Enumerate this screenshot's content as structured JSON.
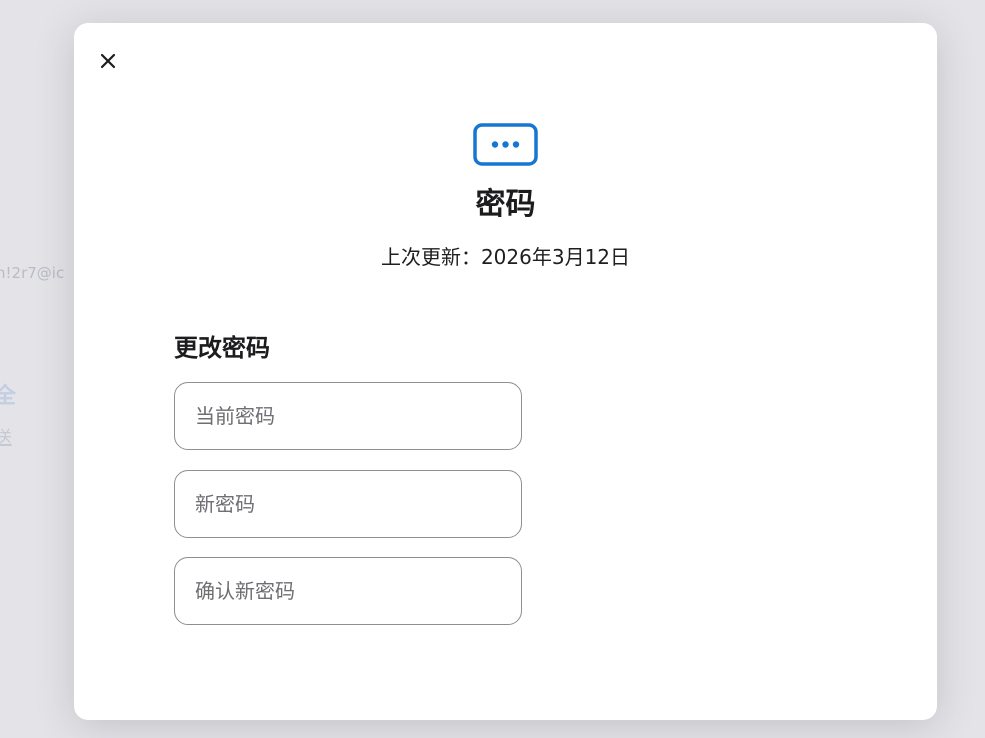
{
  "background": {
    "email_fragment": "h!2r7@ic",
    "glyph_fragment_1": "全",
    "glyph_fragment_2": "送"
  },
  "modal": {
    "close_icon": "close-icon",
    "header_icon": "password-dots-icon",
    "title": "密码",
    "last_updated": "上次更新：2026年3月12日"
  },
  "change_password": {
    "heading": "更改密码",
    "current_placeholder": "当前密码",
    "new_placeholder": "新密码",
    "confirm_placeholder": "确认新密码"
  },
  "colors": {
    "accent": "#1677d2",
    "backdrop": "#e4e4e8"
  }
}
